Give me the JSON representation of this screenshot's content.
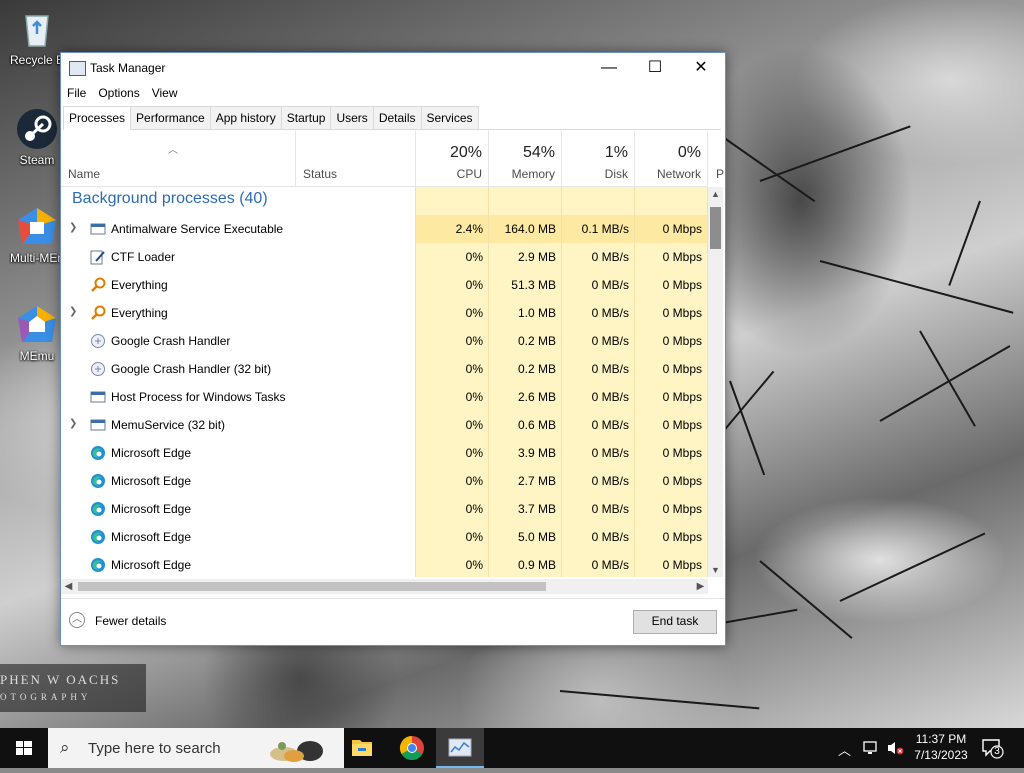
{
  "desktop": {
    "icons": [
      {
        "label": "Recycle Bin",
        "shown": "Recycle B"
      },
      {
        "label": "Steam",
        "shown": "Steam"
      },
      {
        "label": "Multi-MEmu",
        "shown": "Multi-MEn"
      },
      {
        "label": "MEmu",
        "shown": "MEmu"
      }
    ],
    "watermark": {
      "line1": "PHEN W OACHS",
      "line2": "OTOGRAPHY"
    }
  },
  "window": {
    "title": "Task Manager",
    "controls": {
      "minimize": "—",
      "maximize": "☐",
      "close": "✕"
    },
    "menu": [
      "File",
      "Options",
      "View"
    ],
    "tabs": [
      "Processes",
      "Performance",
      "App history",
      "Startup",
      "Users",
      "Details",
      "Services"
    ],
    "active_tab": "Processes",
    "columns": {
      "name": "Name",
      "status": "Status",
      "cpu": {
        "pct": "20%",
        "label": "CPU"
      },
      "memory": {
        "pct": "54%",
        "label": "Memory"
      },
      "disk": {
        "pct": "1%",
        "label": "Disk"
      },
      "network": {
        "pct": "0%",
        "label": "Network"
      },
      "power_partial": "P"
    },
    "group_label": "Background processes (40)",
    "processes": [
      {
        "name": "Antimalware Service Executable",
        "expandable": true,
        "icon": "window-icon",
        "cpu": "2.4%",
        "memory": "164.0 MB",
        "disk": "0.1 MB/s",
        "network": "0 Mbps"
      },
      {
        "name": "CTF Loader",
        "expandable": false,
        "icon": "pen-icon",
        "cpu": "0%",
        "memory": "2.9 MB",
        "disk": "0 MB/s",
        "network": "0 Mbps"
      },
      {
        "name": "Everything",
        "expandable": false,
        "icon": "magnifier-icon",
        "cpu": "0%",
        "memory": "51.3 MB",
        "disk": "0 MB/s",
        "network": "0 Mbps"
      },
      {
        "name": "Everything",
        "expandable": true,
        "icon": "magnifier-icon",
        "cpu": "0%",
        "memory": "1.0 MB",
        "disk": "0 MB/s",
        "network": "0 Mbps"
      },
      {
        "name": "Google Crash Handler",
        "expandable": false,
        "icon": "crash-handler-icon",
        "cpu": "0%",
        "memory": "0.2 MB",
        "disk": "0 MB/s",
        "network": "0 Mbps"
      },
      {
        "name": "Google Crash Handler (32 bit)",
        "expandable": false,
        "icon": "crash-handler-icon",
        "cpu": "0%",
        "memory": "0.2 MB",
        "disk": "0 MB/s",
        "network": "0 Mbps"
      },
      {
        "name": "Host Process for Windows Tasks",
        "expandable": false,
        "icon": "window-icon",
        "cpu": "0%",
        "memory": "2.6 MB",
        "disk": "0 MB/s",
        "network": "0 Mbps"
      },
      {
        "name": "MemuService (32 bit)",
        "expandable": true,
        "icon": "window-icon",
        "cpu": "0%",
        "memory": "0.6 MB",
        "disk": "0 MB/s",
        "network": "0 Mbps"
      },
      {
        "name": "Microsoft Edge",
        "expandable": false,
        "icon": "edge-icon",
        "cpu": "0%",
        "memory": "3.9 MB",
        "disk": "0 MB/s",
        "network": "0 Mbps"
      },
      {
        "name": "Microsoft Edge",
        "expandable": false,
        "icon": "edge-icon",
        "cpu": "0%",
        "memory": "2.7 MB",
        "disk": "0 MB/s",
        "network": "0 Mbps"
      },
      {
        "name": "Microsoft Edge",
        "expandable": false,
        "icon": "edge-icon",
        "cpu": "0%",
        "memory": "3.7 MB",
        "disk": "0 MB/s",
        "network": "0 Mbps"
      },
      {
        "name": "Microsoft Edge",
        "expandable": false,
        "icon": "edge-icon",
        "cpu": "0%",
        "memory": "5.0 MB",
        "disk": "0 MB/s",
        "network": "0 Mbps"
      },
      {
        "name": "Microsoft Edge",
        "expandable": false,
        "icon": "edge-icon",
        "cpu": "0%",
        "memory": "0.9 MB",
        "disk": "0 MB/s",
        "network": "0 Mbps"
      }
    ],
    "footer": {
      "fewer_details": "Fewer details",
      "end_task": "End task"
    }
  },
  "taskbar": {
    "search_placeholder": "Type here to search",
    "time": "11:37 PM",
    "date": "7/13/2023",
    "notification_count": "3",
    "pinned": [
      "file-explorer-icon",
      "chrome-icon",
      "task-manager-icon"
    ],
    "tray": [
      "chevron-up-icon",
      "network-icon",
      "volume-muted-icon"
    ]
  },
  "colors": {
    "accent": "#2e6bb5",
    "cpu_highlight": "#fde9a2",
    "col_shade": "#fff4c4",
    "taskbar": "#101010"
  }
}
